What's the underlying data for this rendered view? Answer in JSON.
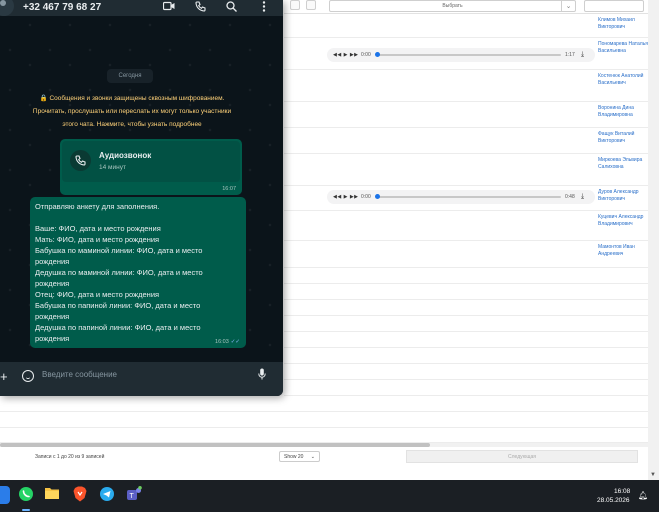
{
  "background_page": {
    "select_placeholder": "Выбрать",
    "rows": [
      {
        "name": "Климов Михаил Викторович",
        "player": null
      },
      {
        "name": "Пономарева Наталья Васильевна",
        "player": {
          "current": "0:00",
          "duration": "1:17",
          "progress": 0
        }
      },
      {
        "name": "Костенюк Анатолий Васильевич",
        "player": null
      },
      {
        "name": "Воронина Дина Владимировна",
        "player": null
      },
      {
        "name": "Фащук Виталий Викторович",
        "player": null
      },
      {
        "name": "Миркоева Эльвира Салиховна",
        "player": null
      },
      {
        "name": "Дуров Александр Викторович",
        "player": {
          "current": "0:00",
          "duration": "0:48",
          "progress": 0
        }
      },
      {
        "name": "Куцевич Александр Владимирович",
        "player": null
      },
      {
        "name": "Мамонтов Иван Андреевич",
        "player": null
      }
    ],
    "footer": {
      "info": "Записи с 1 до 20 из 9 записей",
      "page_size": "Show 20",
      "next_label": "Следующая"
    }
  },
  "whatsapp": {
    "contact_phone": "+32 467 79 68 27",
    "header_icons": [
      "video-icon",
      "phone-icon",
      "search-icon",
      "menu-icon"
    ],
    "date_separator": "Сегодня",
    "encryption_notice": "🔒 Сообщения и звонки защищены сквозным шифрованием. Прочитать, прослушать или переслать их могут только участники этого чата. Нажмите, чтобы узнать подробнее",
    "call_message": {
      "title": "Аудиозвонок",
      "duration": "14 минут",
      "time": "16:07"
    },
    "text_message": {
      "body": "Отправляю анкету для заполнения.\n\nВаше: ФИО, дата и место рождения\nМать: ФИО, дата и место рождения\nБабушка по маминой линии: ФИО, дата и место рождения\nДедушка по маминой линии: ФИО, дата и место рождения\nОтец: ФИО, дата и место рождения\nБабушка по папиной линии: ФИО, дата и место рождения\nДедушка по папиной линии: ФИО, дата и место рождения",
      "time": "16:03"
    },
    "input_placeholder": "Введите сообщение",
    "colors": {
      "bg": "#0b141a",
      "header": "#202c33",
      "outgoing": "#005c4b",
      "notice": "#ffd279"
    }
  },
  "taskbar": {
    "apps": [
      "windows-start",
      "whatsapp",
      "file-explorer",
      "brave-browser",
      "telegram",
      "teams"
    ],
    "time": "16:08",
    "date": "28.05.2026"
  }
}
